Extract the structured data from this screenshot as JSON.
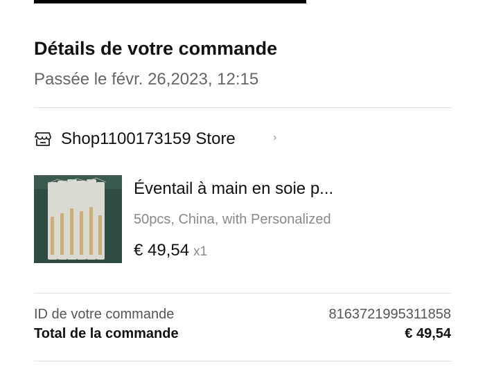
{
  "order": {
    "title": "Détails de votre commande",
    "placed_date": "Passée le févr. 26,2023, 12:15"
  },
  "store": {
    "icon": "store-icon",
    "name": "Shop1100173159 Store",
    "chevron": "›"
  },
  "product": {
    "title": "Éventail à main en soie p...",
    "variant": "50pcs, China, with Personalized",
    "price": "€ 49,54",
    "quantity": "x1"
  },
  "summary": {
    "order_id_label": "ID de votre commande",
    "order_id_value": "8163721995311858",
    "total_label": "Total de la commande",
    "total_value": "€ 49,54"
  },
  "colors": {
    "text_primary": "#111111",
    "text_secondary": "#666666",
    "text_muted": "#8a8a8a",
    "divider": "#e2e2e2"
  }
}
